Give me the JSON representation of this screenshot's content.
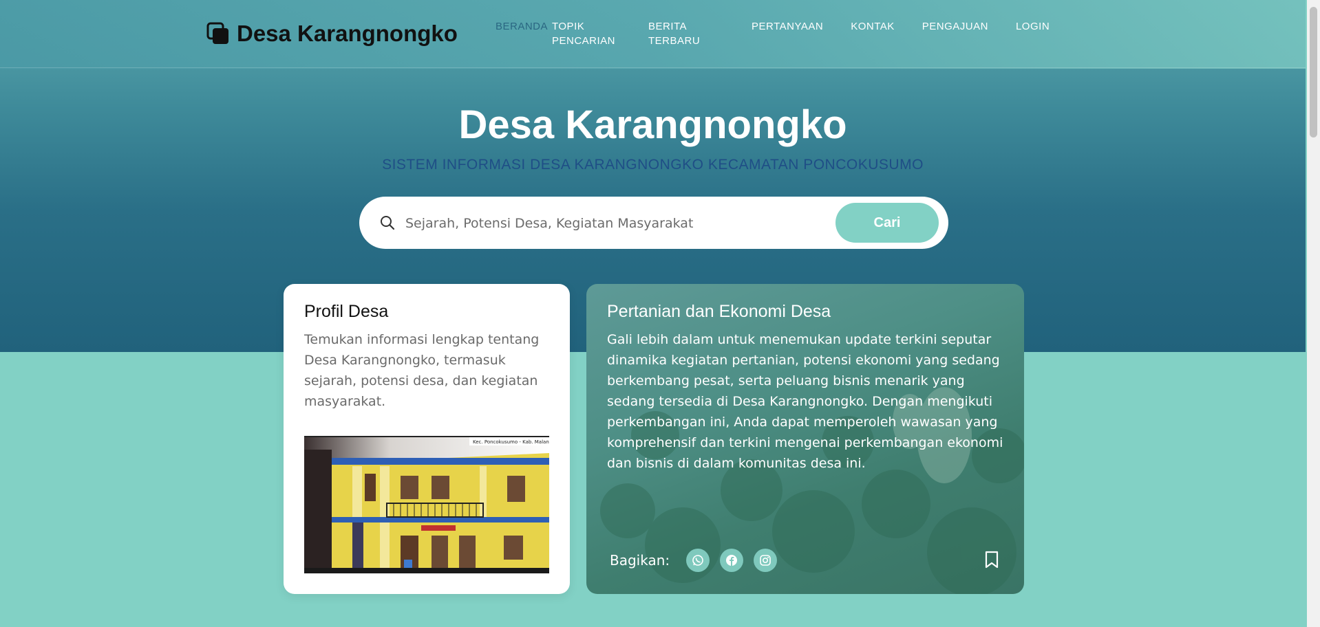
{
  "brand": {
    "name": "Desa Karangnongko",
    "icon": "squares-icon"
  },
  "nav": {
    "items": [
      {
        "label": "BERANDA",
        "active": true
      },
      {
        "label": "TOPIK\nPENCARIAN"
      },
      {
        "label": "BERITA\nTERBARU"
      },
      {
        "label": "PERTANYAAN"
      },
      {
        "label": "KONTAK"
      },
      {
        "label": "PENGAJUAN"
      },
      {
        "label": "LOGIN"
      }
    ]
  },
  "hero": {
    "title": "Desa Karangnongko",
    "subtitle": "SISTEM INFORMASI DESA KARANGNONGKO KECAMATAN PONCOKUSUMO"
  },
  "search": {
    "placeholder": "Sejarah, Potensi Desa, Kegiatan Masyarakat",
    "button_label": "Cari"
  },
  "cards": {
    "profile": {
      "title": "Profil Desa",
      "text": "Temukan informasi lengkap tentang Desa Karangnongko, termasuk sejarah, potensi desa, dan kegiatan masyarakat.",
      "photo_caption": "Kec. Poncokusumo - Kab. Malang"
    },
    "economy": {
      "title": "Pertanian dan Ekonomi Desa",
      "text": "Gali lebih dalam untuk menemukan update terkini seputar dinamika kegiatan pertanian, potensi ekonomi yang sedang berkembang pesat, serta peluang bisnis menarik yang sedang tersedia di Desa Karangnongko. Dengan mengikuti perkembangan ini, Anda dapat memperoleh wawasan yang komprehensif dan terkini mengenai perkembangan ekonomi dan bisnis di dalam komunitas desa ini.",
      "share_label": "Bagikan:",
      "share_icons": [
        "whatsapp-icon",
        "facebook-icon",
        "instagram-icon"
      ]
    }
  },
  "colors": {
    "accent": "#82d1c5",
    "hero_dark": "#21627c",
    "subtitle": "#1f4e86",
    "active_nav": "#2a6782"
  }
}
